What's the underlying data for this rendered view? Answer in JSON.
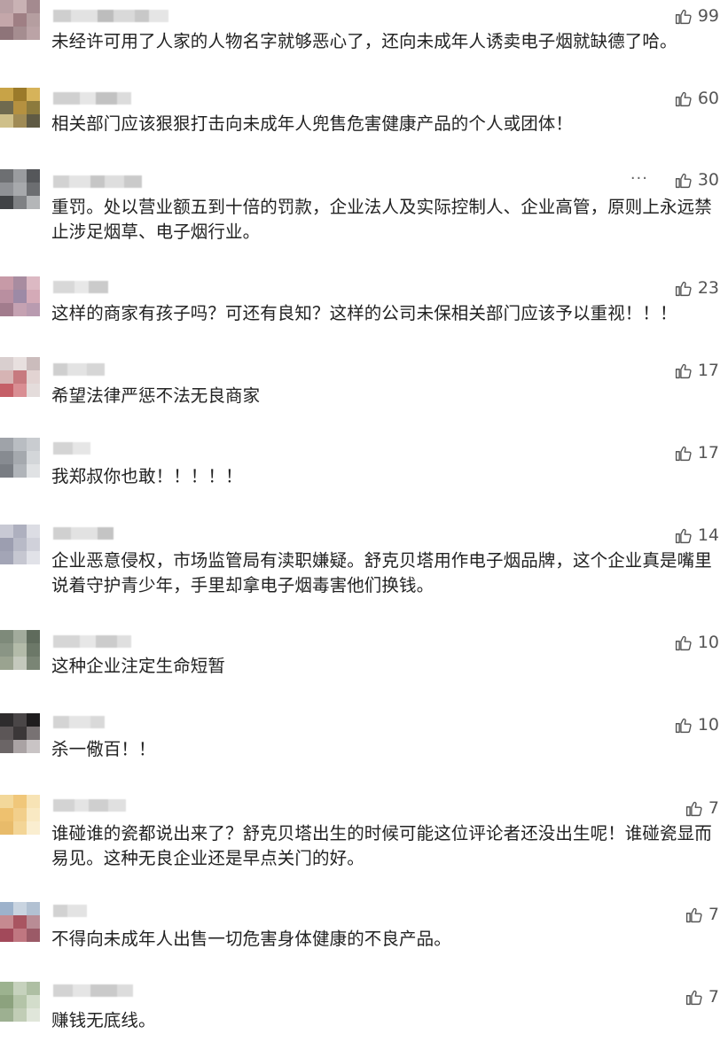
{
  "comments": [
    {
      "likes": "99",
      "text": "未经许可用了人家的人物名字就够恶心了，还向未成年人诱卖电子烟就缺德了哈。",
      "avatar_colors": [
        "#b9a0a4",
        "#c9b2b4",
        "#a48a8f",
        "#c4a7aa",
        "#9f7f84",
        "#b59ea0",
        "#8e7479",
        "#a58d90",
        "#bba3a6"
      ],
      "name_colors": [
        "#cfcfcf",
        "#e2e2e2",
        "#bdbdbd",
        "#d9d9d9",
        "#c8c8c8",
        "#e5e5e5"
      ]
    },
    {
      "likes": "60",
      "text": "相关部门应该狠狠打击向未成年人兜售危害健康产品的个人或团体！",
      "avatar_colors": [
        "#c8a347",
        "#9b7a2a",
        "#d6b35a",
        "#6f6a4f",
        "#b59140",
        "#8c7a3d",
        "#cfc08a",
        "#a08b55",
        "#5f5a44"
      ],
      "name_colors": [
        "#d0d0d0",
        "#e6e6e6",
        "#c2c2c2",
        "#dcdcdc"
      ]
    },
    {
      "likes": "30",
      "text": "重罚。处以营业额五到十倍的罚款，企业法人及实际控制人、企业高管，原则上永远禁止涉足烟草、电子烟行业。",
      "avatar_colors": [
        "#6d6f72",
        "#9a9c9f",
        "#55575a",
        "#8f9195",
        "#a7a9ac",
        "#6c6e71",
        "#414346",
        "#7f8184",
        "#b4b6b8"
      ],
      "name_colors": [
        "#d2d2d2",
        "#e4e4e4",
        "#c6c6c6",
        "#dedede",
        "#cacaca"
      ]
    },
    {
      "likes": "23",
      "text": "这样的商家有孩子吗？可还有良知？这样的公司未保相关部门应该予以重视！！！",
      "avatar_colors": [
        "#c79aa7",
        "#a88ca0",
        "#dcb9c3",
        "#b98fa0",
        "#9d8aa6",
        "#d4aab7",
        "#a27c8d",
        "#c5a2b2",
        "#b99bb0"
      ],
      "name_colors": [
        "#d8d8d8",
        "#e8e8e8",
        "#cbcbcb"
      ]
    },
    {
      "likes": "17",
      "text": "希望法律严惩不法无良商家",
      "avatar_colors": [
        "#d9cfcf",
        "#e8e0df",
        "#cbbcbc",
        "#d6b4b4",
        "#c77a7f",
        "#e2d3d2",
        "#c55f67",
        "#d98e93",
        "#e4dcdb"
      ],
      "name_colors": [
        "#cfcfcf",
        "#e3e3e3",
        "#d6d6d6"
      ]
    },
    {
      "likes": "17",
      "text": "我郑叔你也敢！！！！！",
      "avatar_colors": [
        "#9fa3a9",
        "#b9bdc2",
        "#c9ccd0",
        "#878b91",
        "#a5a9ae",
        "#d3d6d9",
        "#797d83",
        "#b0b4b9",
        "#e0e2e4"
      ],
      "name_colors": [
        "#d4d4d4",
        "#e6e6e6"
      ]
    },
    {
      "likes": "14",
      "text": "企业恶意侵权，市场监管局有渎职嫌疑。舒克贝塔用作电子烟品牌，这个企业真是嘴里说着守护青少年，手里却拿电子烟毒害他们换钱。",
      "avatar_colors": [
        "#c8c9d4",
        "#aeb0bf",
        "#dcdde4",
        "#9c9eb0",
        "#b8bac7",
        "#d0d1da",
        "#a3a5b6",
        "#c6c7d1",
        "#e1e2e8"
      ],
      "name_colors": [
        "#d0d0d0",
        "#e2e2e2",
        "#c4c4c4"
      ]
    },
    {
      "likes": "10",
      "text": "这种企业注定生命短暂",
      "avatar_colors": [
        "#7e8a7a",
        "#a2ab9c",
        "#5f6b5c",
        "#8a9585",
        "#b3bba9",
        "#6c7868",
        "#9aa390",
        "#c4c9bd",
        "#7a8575"
      ],
      "name_colors": [
        "#d6d6d6",
        "#e7e7e7",
        "#cccccc",
        "#dfdfdf"
      ]
    },
    {
      "likes": "10",
      "text": "杀一儆百！！",
      "avatar_colors": [
        "#2e2c2d",
        "#4a4647",
        "#1f1d1e",
        "#5c5657",
        "#3b3738",
        "#787273",
        "#6b6566",
        "#aaa3a4",
        "#c9c4c5"
      ],
      "name_colors": [
        "#d4d4d4",
        "#e5e5e5",
        "#d9d9d9"
      ]
    },
    {
      "likes": "7",
      "text": "谁碰谁的瓷都说出来了？舒克贝塔出生的时候可能这位评论者还没出生呢！谁碰瓷显而易见。这种无良企业还是早点关门的好。",
      "avatar_colors": [
        "#f3d89a",
        "#f0c77a",
        "#f7e3b5",
        "#eec16f",
        "#f2cf8b",
        "#f9e9c3",
        "#e8bb6a",
        "#f3d596",
        "#faeed0"
      ],
      "name_colors": [
        "#d3d3d3",
        "#e4e4e4",
        "#cfcfcf",
        "#e0e0e0"
      ]
    },
    {
      "likes": "7",
      "text": "不得向未成年人出售一切危害身体健康的不良产品。",
      "avatar_colors": [
        "#9db2cb",
        "#c9d4e0",
        "#b2c1d2",
        "#c68a90",
        "#a95561",
        "#b98c95",
        "#a2495a",
        "#c07781",
        "#9b5a67"
      ],
      "name_colors": [
        "#d2d2d2",
        "#e3e3e3"
      ]
    },
    {
      "likes": "7",
      "text": "赚钱无底线。",
      "avatar_colors": [
        "#9cb28f",
        "#c6d2bd",
        "#aebfa3",
        "#8ca27e",
        "#b4c4a8",
        "#d3ddcb",
        "#9db091",
        "#c1cdb6",
        "#e0e6da"
      ],
      "name_colors": [
        "#d3d3d3",
        "#e5e5e5",
        "#cacaca",
        "#dcdcdc"
      ]
    }
  ],
  "more_label": "···",
  "icon_name": "thumbs-up-icon",
  "more_icon_name": "more-icon"
}
